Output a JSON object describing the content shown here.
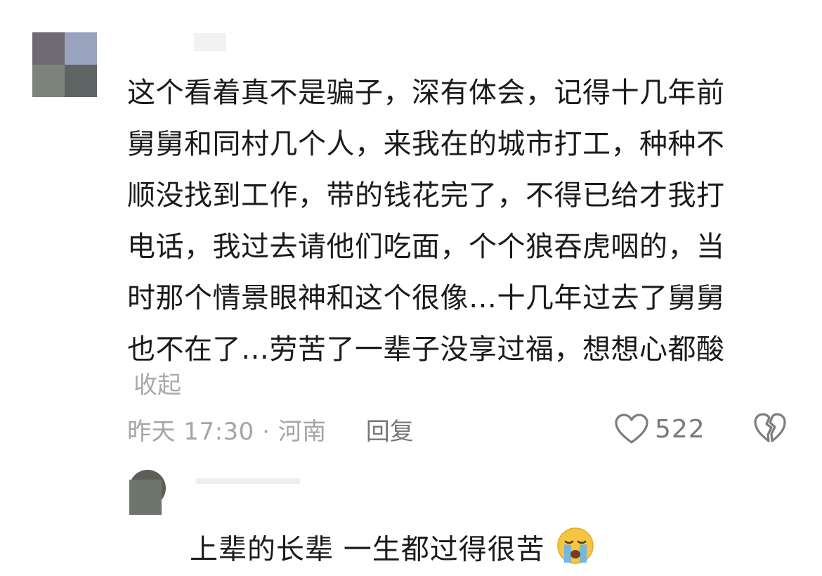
{
  "comment": {
    "lines": [
      "这个看着真不是骗子，深有体会，记得十几年前",
      "舅舅和同村几个人，来我在的城市打工，种种不",
      "顺没找到工作，带的钱花完了，不得已给才我打",
      "电话，我过去请他们吃面，个个狼吞虎咽的，当",
      "时那个情景眼神和这个很像…十几年过去了舅舅",
      "也不在了…劳苦了一辈子没享过福，想想心都酸"
    ],
    "collapse_label": "收起",
    "meta": "昨天 17:30 · 河南",
    "reply_label": "回复",
    "like_count": "522",
    "icons": {
      "like": "heart-outline-icon",
      "dislike": "broken-heart-icon"
    }
  },
  "reply": {
    "text": "上辈的长辈 一生都过得很苦",
    "emoji": "crying-face-emoji"
  }
}
